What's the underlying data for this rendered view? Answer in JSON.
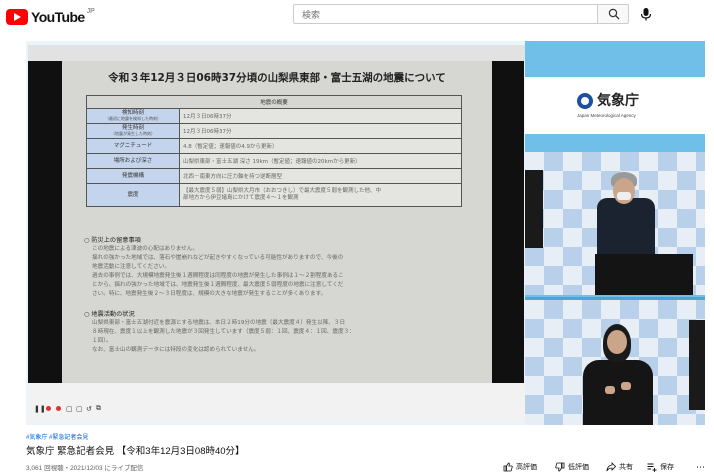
{
  "header": {
    "logo_text": "YouTube",
    "country_code": "JP",
    "search_placeholder": "検索"
  },
  "slide": {
    "title": "令和３年12月３日06時37分頃の山梨県東部・富士五湖の地震について",
    "table_header": "地震の概要",
    "rows": [
      {
        "label": "検知時刻",
        "sub": "（最初に地震を検知した時刻）",
        "value": "12月３日06時37分"
      },
      {
        "label": "発生時刻",
        "sub": "（地震が発生した時刻）",
        "value": "12月３日06時37分"
      },
      {
        "label": "マグニチュード",
        "sub": "",
        "value": "4.8（暫定値；速報値の4.9から更新）"
      },
      {
        "label": "場所および深さ",
        "sub": "",
        "value": "山梨県東部・富士五湖 深さ 19km（暫定値；速報値の20kmから更新）"
      },
      {
        "label": "発震機構",
        "sub": "",
        "value": "北西－南東方向に圧力軸を持つ逆断層型"
      },
      {
        "label": "震度",
        "sub": "",
        "value_lines": [
          "【最大震度５弱】山梨県大月市（おおつきし）で最大震度５弱を観測した他、中",
          "部地方から伊豆諸島にかけて震度４～１を観測"
        ]
      }
    ],
    "section1": "○ 防災上の留意事項",
    "para1": [
      "この地震による津波の心配はありません。",
      "揺れの強かった地域では、落石や崖崩れなどが起きやすくなっている可能性がありますので、今後の",
      "地震活動に注意してください。",
      "過去の事例では、大規模地震発生後１週間程度は同程度の地震が発生した事例は１～２割程度あるこ",
      "とから、揺れの強かった地域では、地震発生後１週間程度、最大震度５弱程度の地震に注意してくだ",
      "さい。特に、地震発生後２～３日程度は、規模の大きな地震が発生することが多くあります。"
    ],
    "section2": "○ 地震活動の状況",
    "para2": [
      "山梨県東部・富士五湖付近を震源とする地震は、本日２時19分の地震（最大震度４）発生以降、３日",
      "８時現在、震度１以上を観測した地震が３回発生しています（震度５弱：１回、震度４：１回、震度３：",
      "１回）。",
      "なお、富士山の観測データには特段の変化は認められていません。"
    ]
  },
  "jma": {
    "name": "気象庁",
    "name_en": "Japan Meteorological Agency"
  },
  "video": {
    "tags": "#気象庁 #緊急記者会見",
    "title": "気象庁 緊急記者会見 【令和3年12月3日08時40分】",
    "meta": "3,061 回視聴・2021/12/03 にライブ配信"
  },
  "actions": {
    "like": "高評価",
    "dislike": "低評価",
    "share": "共有",
    "save": "保存"
  },
  "colors": {
    "brand_red": "#ff0000",
    "link_blue": "#065fd4",
    "frame_blue": "#6fbfe8"
  }
}
